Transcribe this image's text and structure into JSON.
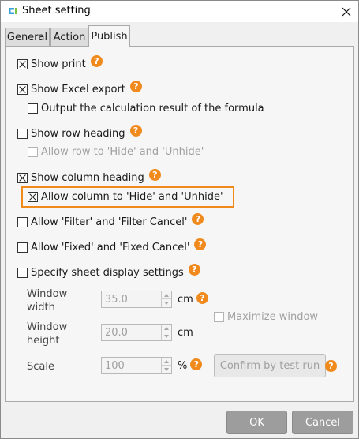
{
  "window": {
    "title": "Sheet setting",
    "close_icon": "close-icon"
  },
  "tabs": [
    {
      "label": "General",
      "active": false
    },
    {
      "label": "Action",
      "active": false
    },
    {
      "label": "Publish",
      "active": true
    }
  ],
  "options": {
    "show_print": {
      "label": "Show print",
      "checked": true
    },
    "show_excel_export": {
      "label": "Show Excel export",
      "checked": true
    },
    "output_formula_result": {
      "label": "Output the calculation result of the formula",
      "checked": false
    },
    "show_row_heading": {
      "label": "Show row heading",
      "checked": false
    },
    "allow_row_hide": {
      "label": "Allow row to 'Hide' and 'Unhide'",
      "checked": false,
      "disabled": true
    },
    "show_column_heading": {
      "label": "Show column heading",
      "checked": true
    },
    "allow_column_hide": {
      "label": "Allow column to 'Hide' and 'Unhide'",
      "checked": true,
      "highlighted": true
    },
    "allow_filter": {
      "label": "Allow 'Filter' and 'Filter Cancel'",
      "checked": false
    },
    "allow_fixed": {
      "label": "Allow 'Fixed' and 'Fixed Cancel'",
      "checked": false
    },
    "specify_display": {
      "label": "Specify sheet display settings",
      "checked": false
    }
  },
  "display_settings": {
    "window_width": {
      "label_line1": "Window",
      "label_line2": "width",
      "value": "35.0",
      "unit": "cm"
    },
    "window_height": {
      "label_line1": "Window",
      "label_line2": "height",
      "value": "20.0",
      "unit": "cm"
    },
    "scale": {
      "label": "Scale",
      "value": "100",
      "unit": "%"
    },
    "maximize_window": {
      "label": "Maximize window",
      "checked": false,
      "disabled": true
    },
    "confirm_button": "Confirm by test run"
  },
  "footer": {
    "ok_label": "OK",
    "cancel_label": "Cancel"
  },
  "colors": {
    "accent": "#f08a1c",
    "help_icon": "#f08a1c"
  },
  "help_glyph": "?"
}
